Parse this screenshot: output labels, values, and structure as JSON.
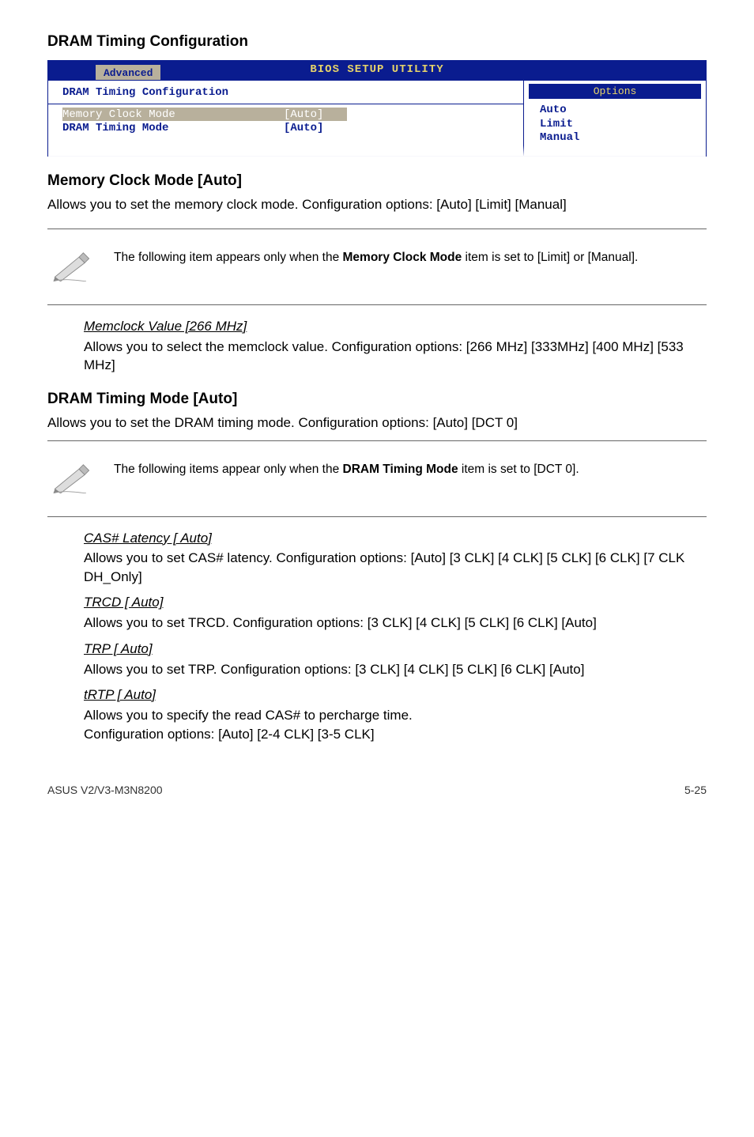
{
  "section_title": "DRAM Timing Configuration",
  "bios": {
    "util_title": "BIOS SETUP UTILITY",
    "tab": "Advanced",
    "config_title": "DRAM Timing Configuration",
    "rows": [
      {
        "label": "Memory Clock Mode",
        "value": "[Auto]",
        "selected": true
      },
      {
        "label": "DRAM Timing Mode",
        "value": "[Auto]",
        "selected": false
      }
    ],
    "options_title": "Options",
    "options": [
      "Auto",
      "Limit",
      "Manual"
    ]
  },
  "mem_clock": {
    "heading": "Memory Clock Mode [Auto]",
    "body": "Allows you to set the memory clock mode. Configuration options: [Auto] [Limit] [Manual]"
  },
  "note1": {
    "prefix": "The following item appears only when the ",
    "bold": "Memory Clock Mode",
    "suffix": " item is set to [Limit] or [Manual]."
  },
  "memclock_value": {
    "title": "Memclock Value [266 MHz]",
    "body": "Allows you to select the memclock value. Configuration options: [266 MHz] [333MHz] [400 MHz] [533 MHz]"
  },
  "dram_timing": {
    "heading": "DRAM Timing Mode [Auto]",
    "body": "Allows you to set the DRAM timing mode. Configuration options: [Auto] [DCT 0]"
  },
  "note2": {
    "prefix": "The following items appear only when the ",
    "bold": "DRAM Timing Mode",
    "suffix": " item is set to [DCT 0]."
  },
  "cas": {
    "title": "CAS# Latency [ Auto]",
    "body": "Allows you to set CAS# latency. Configuration options: [Auto] [3 CLK] [4 CLK] [5 CLK] [6 CLK] [7 CLK DH_Only]"
  },
  "trcd": {
    "title": "TRCD [ Auto]",
    "body": "Allows you to set TRCD. Configuration options: [3 CLK] [4 CLK] [5 CLK] [6 CLK] [Auto]"
  },
  "trp": {
    "title": "TRP [ Auto]",
    "body": "Allows you to set TRP. Configuration options: [3 CLK] [4 CLK] [5 CLK] [6 CLK] [Auto]"
  },
  "trtp": {
    "title": "tRTP [ Auto]",
    "line1": "Allows you to specify the read CAS# to percharge time.",
    "line2": "Configuration options: [Auto] [2-4 CLK] [3-5 CLK]"
  },
  "footer": {
    "left": "ASUS V2/V3-M3N8200",
    "right": "5-25"
  }
}
